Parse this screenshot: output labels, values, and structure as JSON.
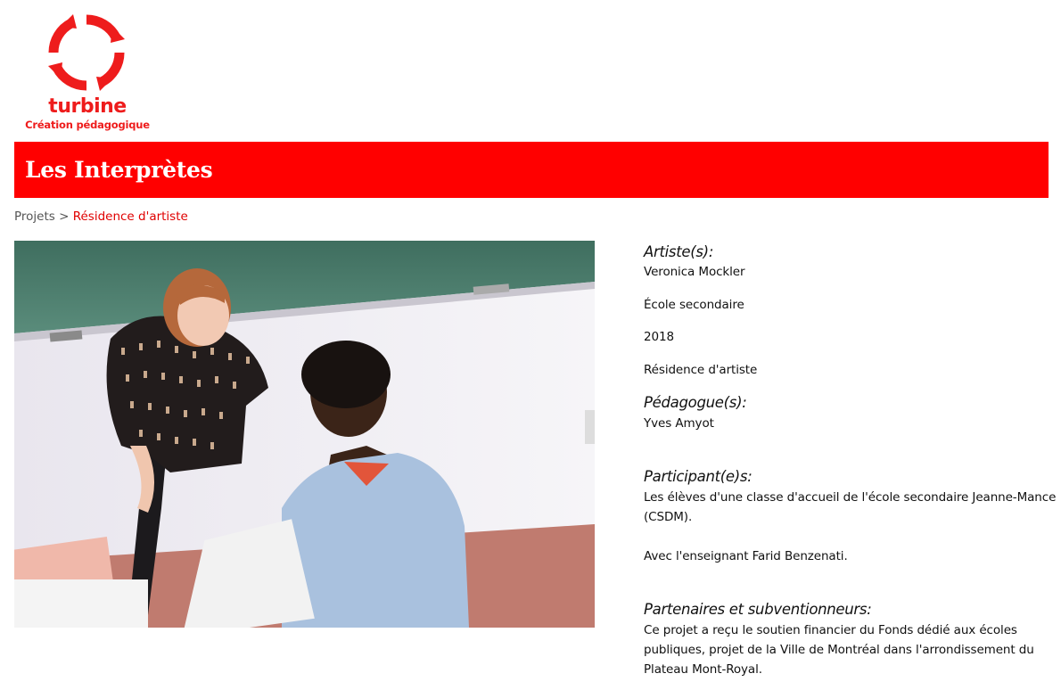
{
  "logo": {
    "wordmark": "turbine",
    "tagline": "Création pédagogique",
    "color": "#ee1c1c"
  },
  "banner": {
    "title": "Les Interprètes",
    "color": "#ff0000"
  },
  "breadcrumb": {
    "parent": "Projets",
    "separator": ">",
    "current": "Résidence d'artiste"
  },
  "photo": {
    "icon": "photo-student-teacher"
  },
  "details": {
    "artists_heading": "Artiste(s):",
    "artists_value": "Veronica Mockler",
    "school_level": "École secondaire",
    "year": "2018",
    "project_type": "Résidence d'artiste",
    "pedagogues_heading": "Pédagogue(s):",
    "pedagogues_value": "Yves Amyot",
    "participants_heading": "Participant(e)s:",
    "participants_line1": "Les élèves d'une classe d'accueil de l'école secondaire Jeanne-Mance",
    "participants_line2": "(CSDM).",
    "participants_teacher": "Avec l'enseignant Farid Benzenati.",
    "partners_heading": "Partenaires et subventionneurs:",
    "partners_line1": "Ce projet a reçu le soutien financier du Fonds dédié aux écoles",
    "partners_line2": "publiques, projet de la Ville de Montréal dans l'arrondissement du",
    "partners_line3": "Plateau Mont-Royal."
  }
}
